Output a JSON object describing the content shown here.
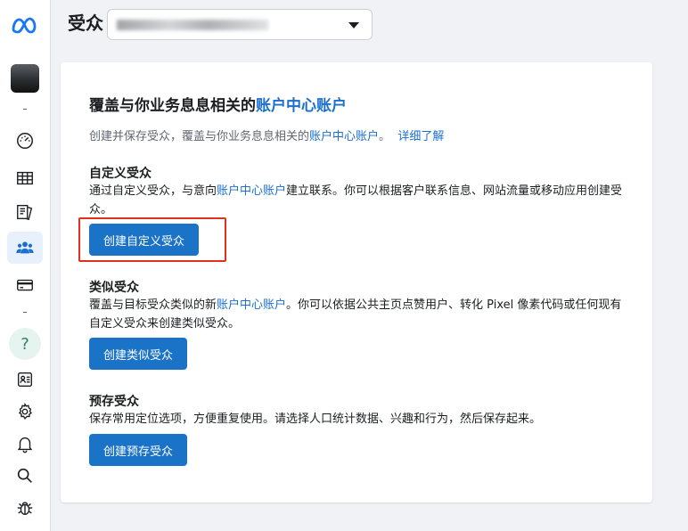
{
  "header": {
    "title": "受众"
  },
  "account_select": {
    "value": ""
  },
  "card": {
    "title_prefix": "覆盖与你业务息息相关的",
    "title_link": "账户中心账户",
    "subtitle_prefix": "创建并保存受众，覆盖与你业务息息相关的",
    "subtitle_link": "账户中心账户",
    "subtitle_suffix": "。",
    "learn_more": "详细了解",
    "sections": [
      {
        "title": "自定义受众",
        "desc_prefix": "通过自定义受众，与意向",
        "desc_link": "账户中心账户",
        "desc_suffix": "建立联系。你可以根据客户联系信息、网站流量或移动应用创建受众。",
        "button": "创建自定义受众"
      },
      {
        "title": "类似受众",
        "desc_prefix": "覆盖与目标受众类似的新",
        "desc_link": "账户中心账户",
        "desc_suffix": "。你可以依据公共主页点赞用户、转化 Pixel 像素代码或任何现有自定义受众来创建类似受众。",
        "button": "创建类似受众"
      },
      {
        "title": "预存受众",
        "desc_prefix": "保存常用定位选项，方便重复使用。请选择人口统计数据、兴趣和行为，然后保存起来。",
        "desc_link": "",
        "desc_suffix": "",
        "button": "创建预存受众"
      }
    ]
  },
  "sidebar": {
    "items": [
      {
        "icon": "meta-logo-icon"
      },
      {
        "icon": "account-avatar"
      },
      {
        "icon": "dashboard-gauge-icon"
      },
      {
        "icon": "table-icon"
      },
      {
        "icon": "pages-icon"
      },
      {
        "icon": "audience-people-icon",
        "active": true
      },
      {
        "icon": "billing-card-icon"
      },
      {
        "icon": "help-icon",
        "label": "?"
      },
      {
        "icon": "news-icon"
      },
      {
        "icon": "settings-gear-icon"
      },
      {
        "icon": "bell-icon"
      },
      {
        "icon": "search-icon"
      },
      {
        "icon": "bug-icon"
      }
    ]
  },
  "colors": {
    "accent": "#1a73c7",
    "link": "#1a6fcf",
    "highlight": "#e0301e",
    "active_bg": "#e7f0fb"
  }
}
